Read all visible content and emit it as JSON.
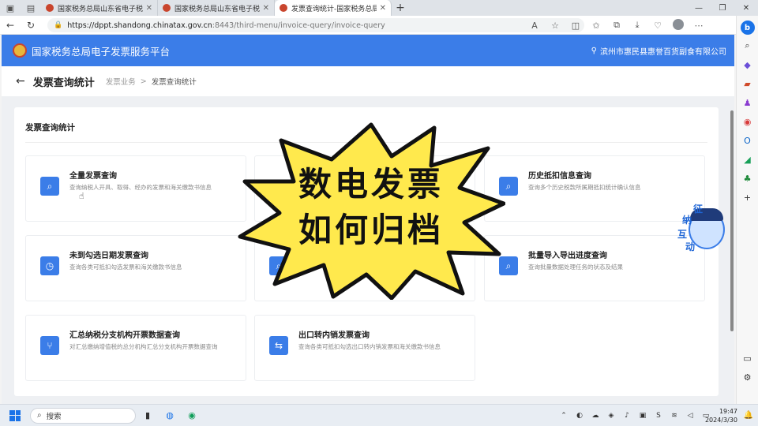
{
  "browser": {
    "tabs": [
      {
        "title": "国家税务总局山东省电子税务局",
        "active": false
      },
      {
        "title": "国家税务总局山东省电子税务局",
        "active": false
      },
      {
        "title": "发票查询统计-国家税务总局电子",
        "active": true
      }
    ],
    "url_host": "https://dppt.shandong.chinatax.gov.cn",
    "url_path": ":8443/third-menu/invoice-query/invoice-query"
  },
  "header": {
    "title": "国家税务总局电子发票服务平台",
    "company": "滨州市惠民县惠誉百货副食有限公司"
  },
  "page": {
    "title": "发票查询统计",
    "breadcrumb_parent": "发票业务",
    "breadcrumb_sep": ">",
    "breadcrumb_current": "发票查询统计"
  },
  "section": {
    "title": "发票查询统计"
  },
  "cards": [
    {
      "name": "全量发票查询",
      "desc": "查询纳税人开具、取得、经办的发票和海关缴款书信息",
      "icon": "⌕"
    },
    {
      "name": "",
      "desc": "",
      "icon": ""
    },
    {
      "name": "历史抵扣信息查询",
      "desc": "查询多个历史税款所属期抵扣统计确认信息",
      "icon": "⌕"
    },
    {
      "name": "未到勾选日期发票查询",
      "desc": "查询各类可抵扣勾选发票和海关缴款书信息",
      "icon": "◷"
    },
    {
      "name": "",
      "desc": "",
      "icon": "⌕"
    },
    {
      "name": "批量导入导出进度查询",
      "desc": "查询批量数据处理任务的状态及结果",
      "icon": "⌕"
    },
    {
      "name": "汇总纳税分支机构开票数据查询",
      "desc": "对汇总缴纳增值税的总分机构汇总分支机构开票数据查询",
      "icon": "⑂"
    },
    {
      "name": "出口转内销发票查询",
      "desc": "查询各类可抵扣勾选出口转内销发票和海关缴款书信息",
      "icon": "⇆"
    }
  ],
  "overlay": {
    "line1": "数电发票",
    "line2": "如何归档"
  },
  "mascot": {
    "chars": [
      "征",
      "纳",
      "互",
      "动"
    ]
  },
  "taskbar": {
    "search_label": "搜索",
    "time": "19:47",
    "date": "2024/3/30"
  },
  "colors": {
    "brand_blue": "#3b7de8",
    "burst_yellow": "#ffe94d"
  }
}
